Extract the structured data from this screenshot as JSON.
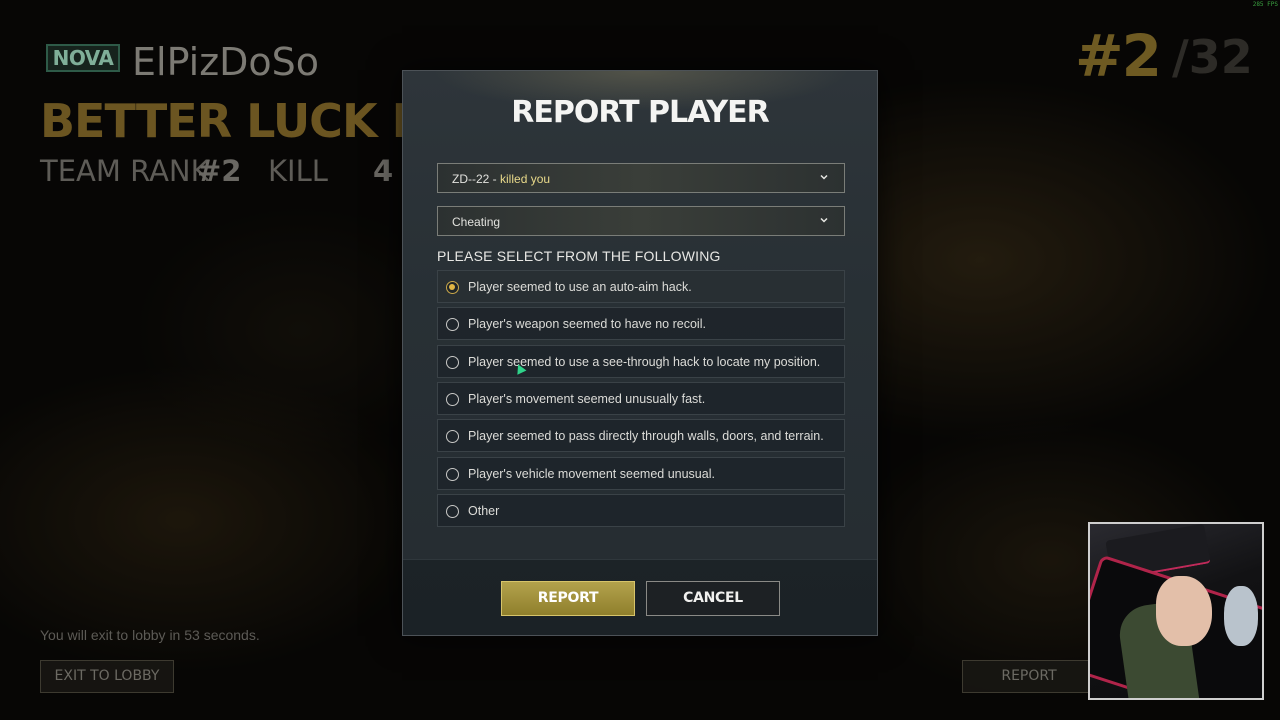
{
  "background": {
    "tier_badge": "NOVA",
    "player_name": "ElPizDoSo",
    "result_title": "BETTER LUCK NEXT TIME",
    "team_rank_label": "TEAM RANK",
    "team_rank_value": "#2",
    "kill_label": "KILL",
    "kill_value": "4",
    "placement": "#2",
    "placement_total": "/32",
    "exit_note": "You will exit to lobby in 53 seconds.",
    "exit_button": "EXIT TO LOBBY",
    "report_button": "REPORT",
    "fps": "285 FPS"
  },
  "modal": {
    "title": "REPORT PLAYER",
    "player_dropdown": {
      "name": "ZD--22",
      "suffix": "killed you"
    },
    "reason_dropdown": "Cheating",
    "section_label": "PLEASE SELECT FROM THE FOLLOWING",
    "options": [
      {
        "label": "Player seemed to use an auto-aim hack.",
        "selected": true
      },
      {
        "label": "Player's weapon seemed to have no recoil.",
        "selected": false
      },
      {
        "label": "Player seemed to use a see-through hack to locate my position.",
        "selected": false
      },
      {
        "label": "Player's movement seemed unusually fast.",
        "selected": false
      },
      {
        "label": "Player seemed to pass directly through walls, doors, and terrain.",
        "selected": false
      },
      {
        "label": "Player's vehicle movement seemed unusual.",
        "selected": false
      },
      {
        "label": "Other",
        "selected": false
      }
    ],
    "report_label": "REPORT",
    "cancel_label": "CANCEL"
  },
  "colors": {
    "accent_gold": "#e0b544",
    "report_button": "#b3a24c"
  }
}
